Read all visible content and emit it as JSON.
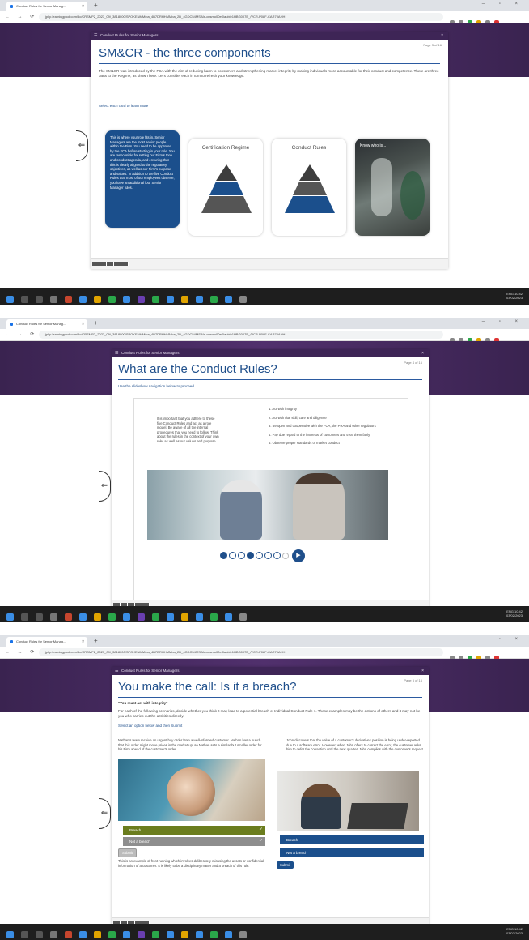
{
  "browser": {
    "tab_title": "Conduct Rules for Senior Manag...",
    "tab_close": "×",
    "new_tab": "+",
    "window_controls": "–  ▫  ×",
    "nav_symbols": "←  →  ⟳",
    "url": "jpl.p.learningpool.com/5c/CRSMP2_2023_09/_3818000/SPOKENMM/ba_4B7DRHHMMba_2D_4GDC54MSAfa-cusmo00ef0auble1HBG007B_/VCR-P08F-CAR70AHH"
  },
  "player_title": "Conduct Rules for Senior Managers",
  "player_close": "×",
  "menu_symbol": "☰",
  "back_arrow": "⇐",
  "slide1": {
    "page": "Page 3 of 16",
    "title": "SM&CR - the three components",
    "intro": "The SM&CR was introduced by the FCA with the aim of reducing harm to consumers and strengthening market integrity by making individuals more accountable for their conduct and competence. There are three parts to the Regime, as shown here. Let's consider each in turn to refresh your knowledge.",
    "instruction": "Select each card to learn more",
    "card1_text": "This is where your role fits in. Senior Managers are the most senior people within the Firm. You need to be approved by the FCA before starting in your role. You are responsible for setting our Firm's tone and conduct agenda, and ensuring that this is clearly aligned to the regulatory objectives, as well as our Firm's purpose and values. In addition to the five Conduct Rules that most of our employees observe, you have an additional four Senior Manager rules.",
    "card2_title": "Certification Regime",
    "card3_title": "Conduct Rules",
    "card4_label": "Know who is..."
  },
  "slide2": {
    "page": "Page 4 of 16",
    "title": "What are the Conduct Rules?",
    "instruction": "Use the slideshow navigation below to proceed",
    "left_text": "It is important that you adhere to these five Conduct Rules and act as a role model. Be aware of all the internal procedures that you need to follow. Think about the rules in the context of your own role, as well as our values and purpose.",
    "rules": [
      "1. Act with integrity",
      "2. Act with due skill, care and diligence",
      "3. Be open and cooperative with the FCA, the PRA and other regulators",
      "4. Pay due regard to the interests of customers and treat them fairly",
      "5. Observe proper standards of market conduct"
    ],
    "next_symbol": "▶"
  },
  "slide3": {
    "page": "Page 5 of 16",
    "title": "You make the call: Is it a breach?",
    "rule_heading": "\"You must act with integrity\"",
    "intro": "For each of the following scenarios, decide whether you think it may lead to a potential breach of Individual Conduct Rule 1. These examples may be the actions of others and it may not be you who carries out the activities directly.",
    "instruction": "Select an option below and then Submit",
    "scenario_left": "Nathan's team receive an urgent buy order from a well-informed customer. Nathan has a hunch that this order might move prices in the market up, so Nathan sets a similar but smaller order for his Firm ahead of the customer's order.",
    "scenario_right": "John discovers that the value of a customer's derivatives position is being under-reported due to a software error. However, when John offers to correct the error, the customer asks him to defer the correction until the next quarter. John complies with the customer's request.",
    "opt_breach": "Breach",
    "opt_not_breach": "Not a breach",
    "check": "✓",
    "submit": "Submit",
    "feedback": "This is an example of front running which involves deliberately misusing the assets or confidential information of a customer. It is likely to be a disciplinary matter and a breach of this rule."
  },
  "taskbar": {
    "time": "10:42",
    "date": "03/02/2023",
    "lang": "ENG"
  }
}
